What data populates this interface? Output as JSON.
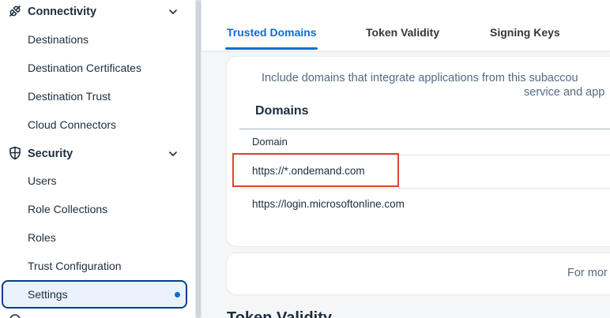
{
  "sidebar": {
    "groups": [
      {
        "label": "Connectivity",
        "icon": "connectivity-icon"
      },
      {
        "label": "Security",
        "icon": "shield-icon"
      }
    ],
    "connectivity_items": [
      {
        "label": "Destinations"
      },
      {
        "label": "Destination Certificates"
      },
      {
        "label": "Destination Trust"
      },
      {
        "label": "Cloud Connectors"
      }
    ],
    "security_items": [
      {
        "label": "Users"
      },
      {
        "label": "Role Collections"
      },
      {
        "label": "Roles"
      },
      {
        "label": "Trust Configuration"
      },
      {
        "label": "Settings",
        "selected": true
      }
    ]
  },
  "tabs": [
    {
      "label": "Trusted Domains",
      "active": true
    },
    {
      "label": "Token Validity",
      "active": false
    },
    {
      "label": "Signing Keys",
      "active": false
    }
  ],
  "trusted_domains": {
    "description_line1": "Include domains that integrate applications from this subaccou",
    "description_line2": "service and app",
    "section_title": "Domains",
    "column_header": "Domain",
    "rows": [
      {
        "domain": "https://*.ondemand.com",
        "highlighted": true
      },
      {
        "domain": "https://login.microsoftonline.com",
        "highlighted": false
      }
    ]
  },
  "token_card": {
    "text": "For mor"
  },
  "next_section_title": "Token Validity",
  "colors": {
    "accent": "#0a6ed1",
    "selected_border": "#0a3e8a",
    "highlight_box": "#e0442a"
  }
}
